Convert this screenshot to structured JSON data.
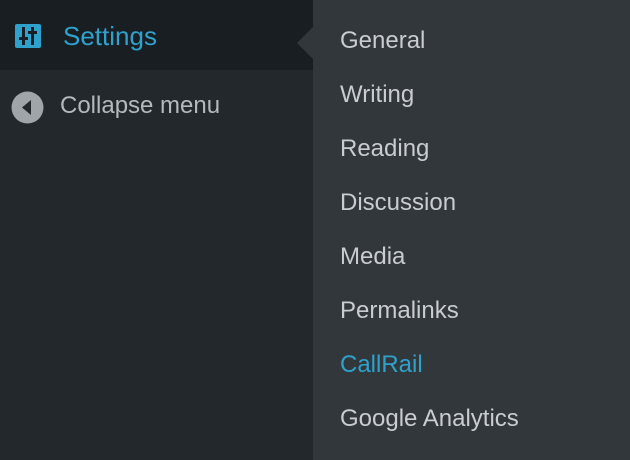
{
  "sidebar": {
    "settings_label": "Settings",
    "collapse_label": "Collapse menu"
  },
  "submenu": {
    "items": [
      {
        "label": "General"
      },
      {
        "label": "Writing"
      },
      {
        "label": "Reading"
      },
      {
        "label": "Discussion"
      },
      {
        "label": "Media"
      },
      {
        "label": "Permalinks"
      },
      {
        "label": "CallRail",
        "active": true
      },
      {
        "label": "Google Analytics"
      }
    ]
  },
  "colors": {
    "accent": "#2ea2cc",
    "sidebar_bg": "#23282d",
    "active_item_bg": "#191e23",
    "submenu_bg": "#32373c",
    "text": "#c9ccd0"
  },
  "icons": {
    "settings": "settings-sliders-icon",
    "collapse": "collapse-arrow-icon"
  }
}
